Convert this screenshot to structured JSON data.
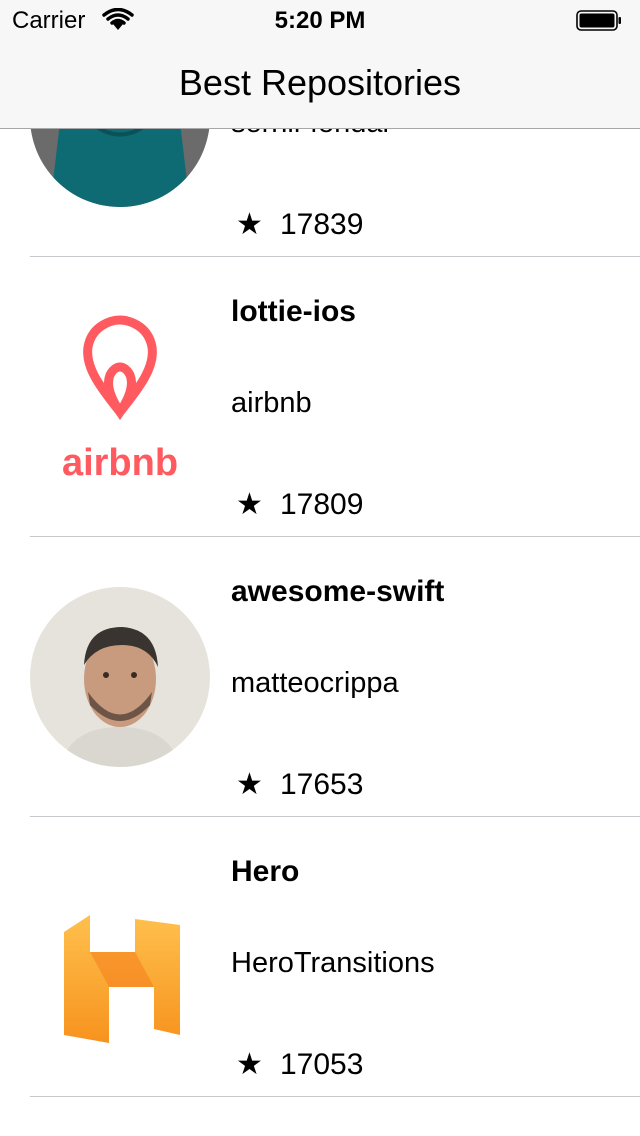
{
  "status_bar": {
    "carrier": "Carrier",
    "time": "5:20 PM"
  },
  "nav": {
    "title": "Best Repositories"
  },
  "repos": [
    {
      "name": "",
      "owner": "sernil-fondal",
      "stars": "17839",
      "avatar": "person-hoodie-avatar"
    },
    {
      "name": "lottie-ios",
      "owner": "airbnb",
      "stars": "17809",
      "avatar": "airbnb-logo",
      "logo_text": "airbnb"
    },
    {
      "name": "awesome-swift",
      "owner": "matteocrippa",
      "stars": "17653",
      "avatar": "person-photo-avatar"
    },
    {
      "name": "Hero",
      "owner": "HeroTransitions",
      "stars": "17053",
      "avatar": "hero-h-logo"
    }
  ],
  "colors": {
    "airbnb": "#ff5a5f",
    "hero_orange": "#f7931e",
    "star": "#000000"
  }
}
